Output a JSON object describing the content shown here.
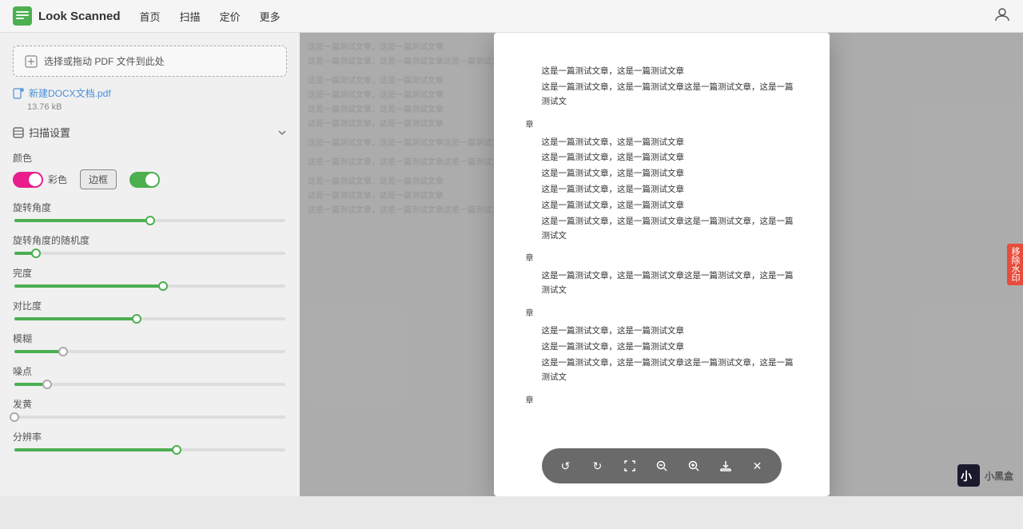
{
  "header": {
    "logo_text": "Look Scanned",
    "nav": [
      {
        "label": "首页"
      },
      {
        "label": "扫描"
      },
      {
        "label": "定价"
      },
      {
        "label": "更多"
      }
    ]
  },
  "sidebar": {
    "upload_label": "选择或拖动 PDF 文件到此处",
    "file_name": "新建DOCX文档.pdf",
    "file_size": "13.76 kB",
    "scan_settings_label": "扫描设置",
    "color_label": "颜色",
    "color_option_color": "彩色",
    "color_option_bw": "边框",
    "rotation_label": "旋转角度",
    "rotation_randomness_label": "旋转角度的随机度",
    "completeness_label": "完度",
    "contrast_label": "对比度",
    "blur_label": "模糊",
    "noise_label": "噪点",
    "yellowing_label": "发黄",
    "resolution_label": "分辨率",
    "slider_rotation_pct": 50,
    "slider_randomness_pct": 8,
    "slider_completeness_pct": 55,
    "slider_contrast_pct": 45,
    "slider_blur_pct": 18,
    "slider_noise_pct": 12,
    "slider_yellowing_pct": 0,
    "slider_resolution_pct": 60
  },
  "document": {
    "lines": [
      "这是一篇测试文章，这是一篇测试文章",
      "这是一篇测试文章，这是一篇测试文章这是一篇测试文章，这是一篇测试文",
      "章",
      "这是一篇测试文章，这是一篇测试文章",
      "这是一篇测试文章，这是一篇测试文章",
      "这是一篇测试文章，这是一篇测试文章",
      "这是一篇测试文章，这是一篇测试文章",
      "这是一篇测试文章，这是一篇测试文章",
      "这是一篇测试文章，这是一篇测试文章这是一篇测试文章，这是一篇测试文",
      "章",
      "这是一篇测试文章，这是一篇测试文章这是一篇测试文章，这是一篇测试文",
      "章",
      "这是一篇测试文章，这是一篇测试文章",
      "这是一篇测试文章，这是一篇测试文章",
      "这是一篇测试文章，这是一篇测试文章这是一篇测试文章，这是一篇测试文",
      "章"
    ]
  },
  "toolbar": {
    "buttons": [
      {
        "icon": "↺",
        "name": "rotate-left"
      },
      {
        "icon": "↻",
        "name": "rotate-right"
      },
      {
        "icon": "⤢",
        "name": "fit-page"
      },
      {
        "icon": "−",
        "name": "zoom-out"
      },
      {
        "icon": "+",
        "name": "zoom-in"
      },
      {
        "icon": "⬇",
        "name": "download"
      },
      {
        "icon": "✕",
        "name": "close"
      }
    ]
  },
  "bg_document": {
    "lines": [
      "这是一篇测试文章，这是一篇测试文章",
      "这是一篇测试文章，这是一篇测试文章这是一篇测试文章这是一篇测试文章，这是一篇测试文",
      "这是一篇测试文章，这是一篇测试文章",
      "这是一篇测试文章，这是一篇测试文章",
      "这是一篇测试文章，这是一篇测试文章",
      "这是一篇测试文章，这是一篇测试文章",
      "这是一篇测试文章，这是一篇测试文章这是一篇测试文章这是一篇测试文章，这是一篇测试文",
      "这是一篇测试文章，这是一篇测试文章这是一篇测试文章这是一篇测试文章，这是一篇测试文",
      "这是一篇测试文章，这是一篇测试文章",
      "这是一篇测试文章，这是一篇测试文章",
      "这是一篇测试文章，这是一篇测试文章这是一篇测试文章这是一篇测试文章，这是一篇测试文"
    ]
  },
  "watermark": {
    "label": "移除水印"
  },
  "bottom_logo": {
    "name": "小黑盒"
  }
}
